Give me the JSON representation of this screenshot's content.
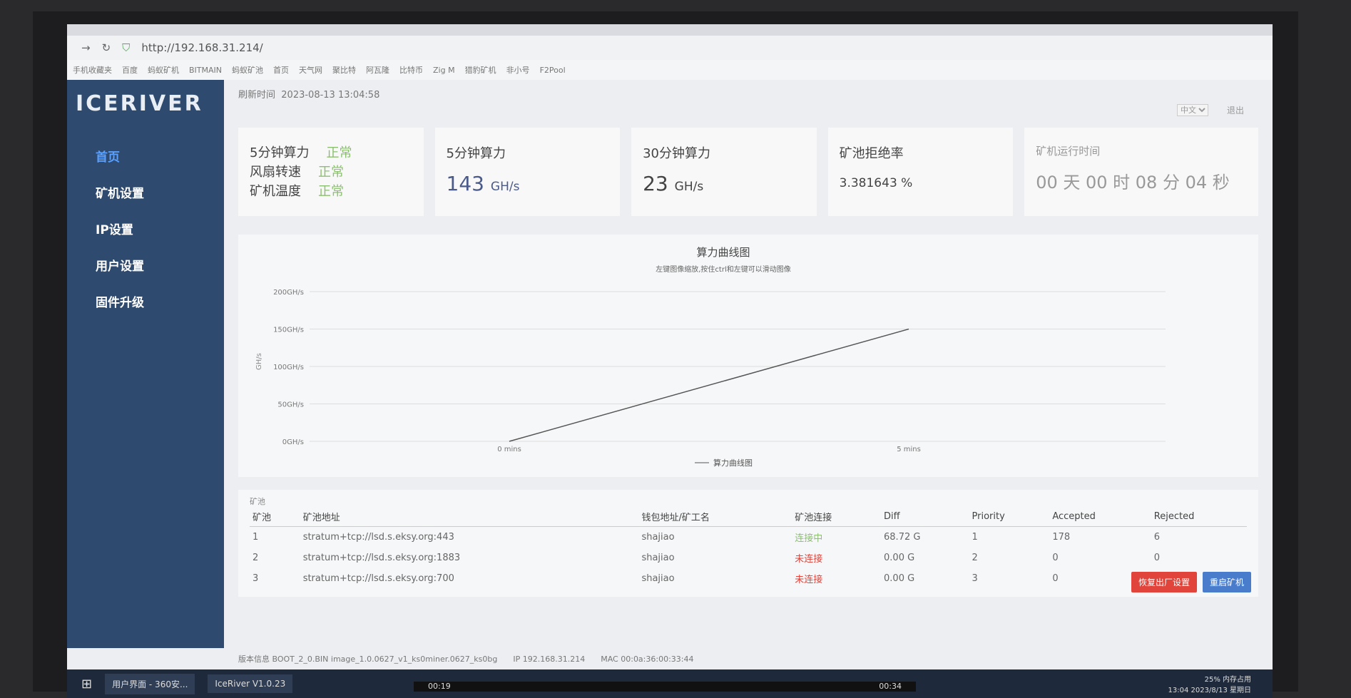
{
  "browser": {
    "url": "http://192.168.31.214/",
    "bookmarks": [
      "手机收藏夹",
      "百度",
      "蚂蚁矿机",
      "BITMAIN",
      "蚂蚁矿池",
      "首页",
      "天气网",
      "聚比特",
      "阿瓦隆",
      "比特币",
      "Zig M",
      "猎豹矿机",
      "非小号",
      "F2Pool"
    ]
  },
  "sidebar": {
    "logo": "ICERIVER",
    "items": [
      {
        "label": "首页"
      },
      {
        "label": "矿机设置"
      },
      {
        "label": "IP设置"
      },
      {
        "label": "用户设置"
      },
      {
        "label": "固件升级"
      }
    ]
  },
  "header": {
    "refresh_label": "刷新时间",
    "refresh_time": "2023-08-13 13:04:58",
    "language": "中文",
    "logout": "退出"
  },
  "status": {
    "rows": [
      {
        "label": "5分钟算力",
        "value": "正常"
      },
      {
        "label": "风扇转速",
        "value": "正常"
      },
      {
        "label": "矿机温度",
        "value": "正常"
      }
    ]
  },
  "cards": [
    {
      "title": "5分钟算力",
      "value": "143",
      "unit": "GH/s"
    },
    {
      "title": "30分钟算力",
      "value": "23",
      "unit": "GH/s"
    },
    {
      "title": "矿池拒绝率",
      "value": "3.381643 %"
    },
    {
      "title": "矿机运行时间",
      "value": "00 天 00 时 08 分 04 秒"
    }
  ],
  "chart_data": {
    "type": "line",
    "title": "算力曲线图",
    "subtitle": "左键图像缩放,按住ctrl和左键可以滑动图像",
    "ylabel": "GH/s",
    "yticks": [
      "0GH/s",
      "50GH/s",
      "100GH/s",
      "150GH/s",
      "200GH/s"
    ],
    "ylim": [
      0,
      200
    ],
    "xticks": [
      "0 mins",
      "5 mins"
    ],
    "series": [
      {
        "name": "算力曲线图",
        "x": [
          0,
          5
        ],
        "y": [
          0,
          150
        ]
      }
    ],
    "grid": true,
    "legend": "bottom"
  },
  "pools": {
    "title": "矿池",
    "headers": [
      "矿池",
      "矿池地址",
      "钱包地址/矿工名",
      "矿池连接",
      "Diff",
      "Priority",
      "Accepted",
      "Rejected"
    ],
    "rows": [
      {
        "id": "1",
        "url": "stratum+tcp://lsd.s.eksy.org:443",
        "worker": "shajiao",
        "state": "连接中",
        "diff": "68.72 G",
        "priority": "1",
        "accepted": "178",
        "rejected": "6"
      },
      {
        "id": "2",
        "url": "stratum+tcp://lsd.s.eksy.org:1883",
        "worker": "shajiao",
        "state": "未连接",
        "diff": "0.00 G",
        "priority": "2",
        "accepted": "0",
        "rejected": "0"
      },
      {
        "id": "3",
        "url": "stratum+tcp://lsd.s.eksy.org:700",
        "worker": "shajiao",
        "state": "未连接",
        "diff": "0.00 G",
        "priority": "3",
        "accepted": "0",
        "rejected": "0"
      }
    ],
    "reset_button": "恢复出厂设置",
    "reboot_button": "重启矿机"
  },
  "footer": {
    "version_label": "版本信息",
    "version": "BOOT_2_0.BIN image_1.0.0627_v1_ks0miner.0627_ks0bg",
    "ip_label": "IP",
    "ip": "192.168.31.214",
    "mac_label": "MAC",
    "mac": "00:0a:36:00:33:44"
  },
  "taskbar": {
    "apps": [
      "用户界面 - 360安...",
      "IceRiver V1.0.23"
    ],
    "memory": "25% 内存占用",
    "time": "13:04",
    "date": "2023/8/13 星期日"
  },
  "player": {
    "current": "00:19",
    "total": "00:34"
  }
}
